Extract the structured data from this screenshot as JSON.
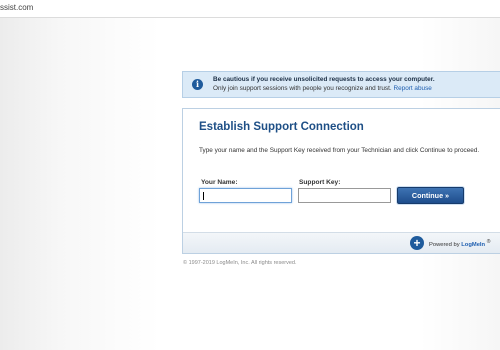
{
  "browser": {
    "url_fragment": "ssist.com"
  },
  "warning": {
    "icon": "info-icon",
    "title": "Be cautious if you receive unsolicited requests to access your computer.",
    "text": "Only join support sessions with people you recognize and trust.",
    "link": "Report abuse"
  },
  "form": {
    "title": "Establish Support Connection",
    "description": "Type your name and the Support Key received from your Technician and click Continue to proceed.",
    "name_label": "Your Name:",
    "name_value": "",
    "key_label": "Support Key:",
    "key_value": "",
    "continue_label": "Continue »"
  },
  "footer": {
    "icon": "plus-icon",
    "powered_prefix": "Powered by",
    "powered_brand": "LogMeIn",
    "registered_mark": "®"
  },
  "copyright": "© 1997-2019 LogMeIn, Inc. All rights reserved.",
  "colors": {
    "accent": "#1f5b9c",
    "title_blue": "#1e4f86",
    "link_blue": "#1f5fb0",
    "warning_bg": "#dbeaf7"
  }
}
